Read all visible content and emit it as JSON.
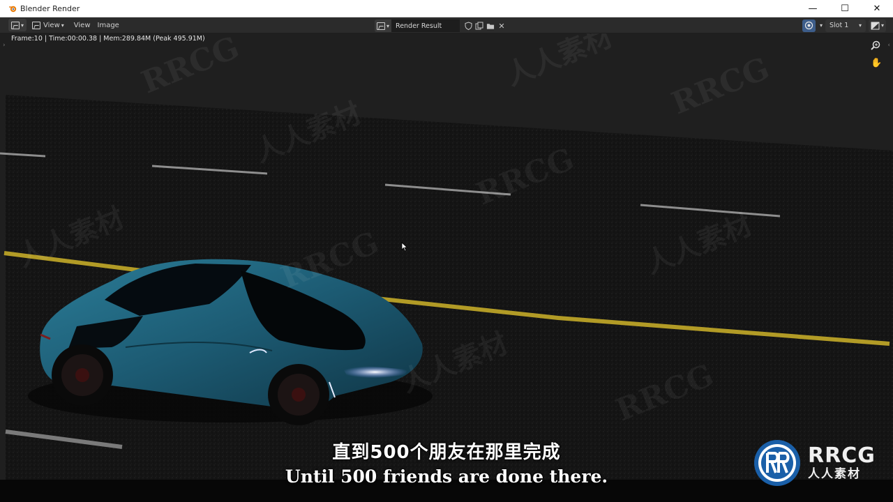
{
  "window": {
    "title": "Blender Render",
    "controls": {
      "minimize": "—",
      "maximize": "☐",
      "close": "✕"
    }
  },
  "header": {
    "menus": [
      "View",
      "Image"
    ],
    "image_name": "Render Result",
    "slot": "Slot 1"
  },
  "viewport": {
    "stats": "Frame:10 | Time:00:00.38 | Mem:289.84M (Peak 495.91M)"
  },
  "subtitles": {
    "chinese": "直到500个朋友在那里完成",
    "english": "Until 500 friends are done there."
  },
  "watermarks": {
    "latin": "RRCG",
    "cjk": "人人素材"
  },
  "logo": {
    "en": "RRCG",
    "cn": "人人素材"
  },
  "colors": {
    "car_body": "#1f5f78",
    "road_line_yellow": "#b8a02a",
    "road_line_white": "#9a9a9a",
    "accent_blue": "#3d5d8a"
  }
}
